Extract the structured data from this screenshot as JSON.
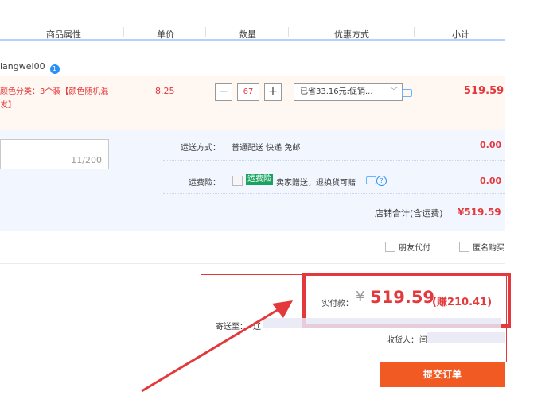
{
  "header": {
    "columns": [
      "商品属性",
      "单价",
      "数量",
      "优惠方式",
      "小计"
    ]
  },
  "shop": {
    "seller_name": "iangwei00",
    "badge": "1"
  },
  "item": {
    "attr_line1": "颜色分类：3个装【颜色随机混",
    "attr_line2": "发】",
    "price": "8.25",
    "qty_minus": "−",
    "qty_value": "67",
    "qty_plus": "+",
    "discount": "已省33.16元:促销...",
    "subtotal": "519.59"
  },
  "shipping": {
    "memo_count": "11/200",
    "method_label": "运送方式：",
    "method_value": "普通配送 快递 免邮",
    "method_fee": "0.00",
    "insurance_label": "运费险：",
    "insurance_tag": "运费险",
    "insurance_desc": "卖家赠送，退换货可赔",
    "insurance_fee": "0.00",
    "shop_total_label": "店铺合计(含运费)",
    "shop_total_value": "¥519.59"
  },
  "options": {
    "friend_pay": "朋友代付",
    "anonymous": "匿名购买"
  },
  "summary": {
    "actual_label": "实付款：",
    "currency": "¥",
    "actual_value": "519.59",
    "earn": "(赚210.41)",
    "ship_to_label": "寄送至：",
    "ship_to_value": "辽",
    "receiver_label": "收货人：",
    "receiver_value": "闫",
    "submit_label": "提交订单"
  },
  "colors": {
    "accent_red": "#e4393c",
    "submit_orange": "#f15a22",
    "header_line_blue": "#b2d1ff",
    "item_bg": "#fff8f2",
    "shipping_bg": "#f2f7ff"
  }
}
